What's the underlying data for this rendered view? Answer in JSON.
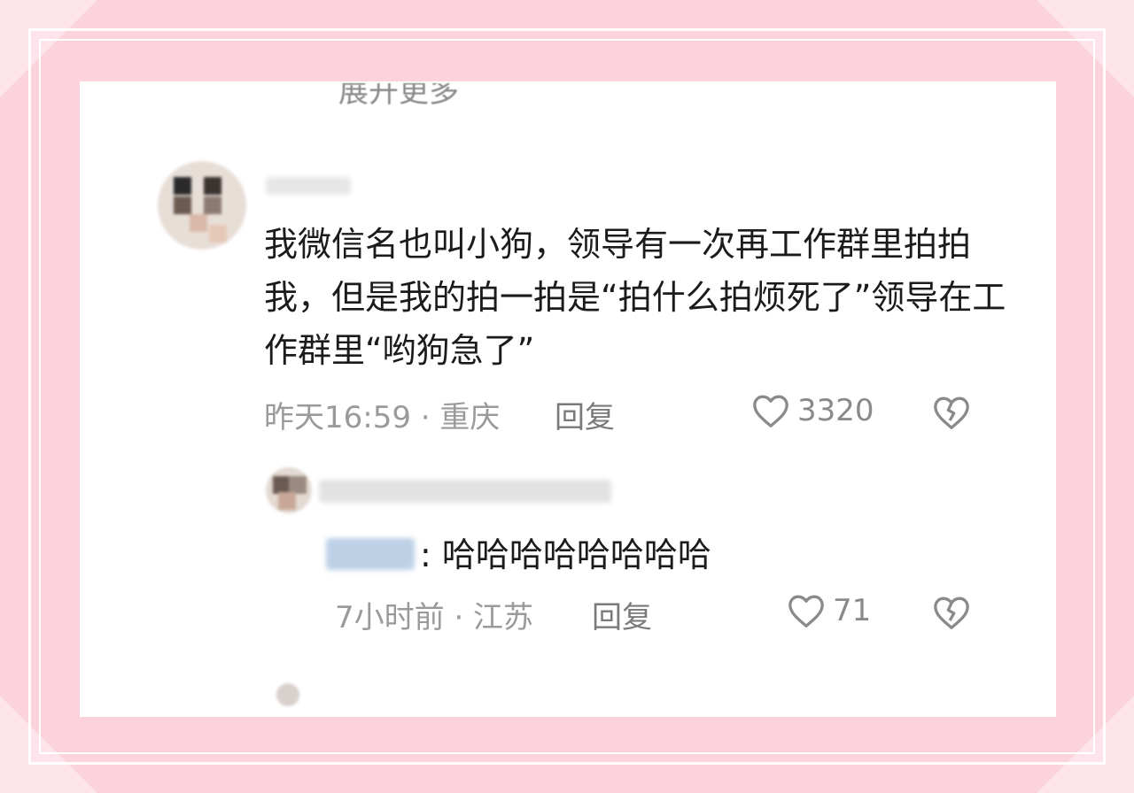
{
  "top_cut": {
    "text": "展开更多"
  },
  "comment": {
    "text": "我微信名也叫小狗，领导有一次再工作群里拍拍我，但是我的拍一拍是“拍什么拍烦死了”领导在工作群里“哟狗急了”",
    "meta": "昨天16:59 · 重庆",
    "reply_label": "回复",
    "likes": "3320"
  },
  "reply": {
    "text": ": 哈哈哈哈哈哈哈哈",
    "meta": "7小时前 · 江苏",
    "reply_label": "回复",
    "likes": "71"
  },
  "colors": {
    "frame": "#fcd3dc",
    "card": "#ffffff",
    "text": "#1b1b1b",
    "meta": "#9a9a9a"
  }
}
